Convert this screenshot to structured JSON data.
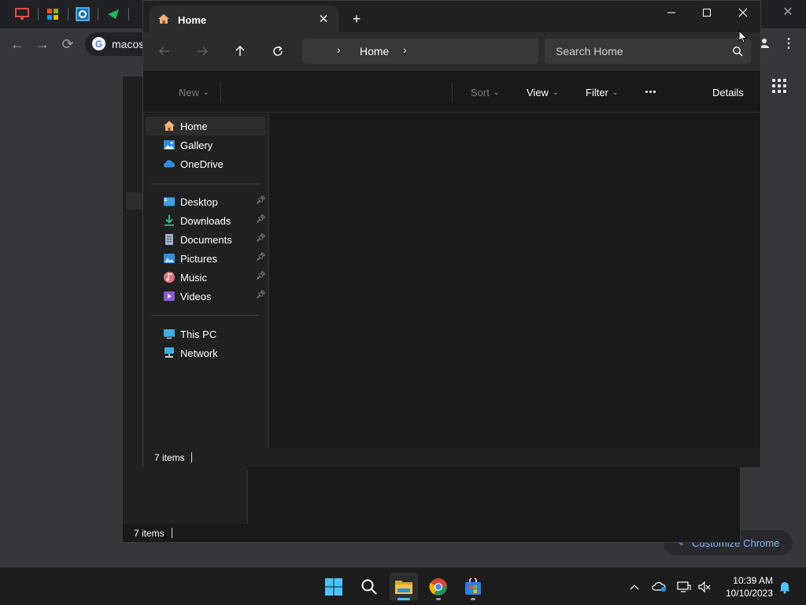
{
  "chrome": {
    "omnibox_text": "macos",
    "google_letter": "G",
    "customize_label": "Customize Chrome"
  },
  "back_explorer": {
    "status_count": "7 items"
  },
  "explorer": {
    "tab_title": "Home",
    "address": {
      "crumb": "Home",
      "search_placeholder": "Search Home"
    },
    "commands": {
      "new": "New",
      "sort": "Sort",
      "view": "View",
      "filter": "Filter",
      "details": "Details"
    },
    "sidebar": {
      "quick": [
        {
          "label": "Home",
          "icon": "home-icon",
          "selected": true
        },
        {
          "label": "Gallery",
          "icon": "gallery-icon"
        },
        {
          "label": "OneDrive",
          "icon": "onedrive-icon"
        }
      ],
      "pinned": [
        {
          "label": "Desktop",
          "icon": "desktop-icon"
        },
        {
          "label": "Downloads",
          "icon": "downloads-icon"
        },
        {
          "label": "Documents",
          "icon": "documents-icon"
        },
        {
          "label": "Pictures",
          "icon": "pictures-icon"
        },
        {
          "label": "Music",
          "icon": "music-icon"
        },
        {
          "label": "Videos",
          "icon": "videos-icon"
        }
      ],
      "system": [
        {
          "label": "This PC",
          "icon": "this-pc-icon"
        },
        {
          "label": "Network",
          "icon": "network-icon"
        }
      ]
    },
    "status_count": "7 items"
  },
  "taskbar": {
    "apps": [
      "start-icon",
      "search-icon",
      "file-explorer-icon",
      "chrome-icon",
      "store-icon"
    ],
    "clock_time": "10:39 AM",
    "clock_date": "10/10/2023"
  },
  "colors": {
    "accent": "#4cc2ff",
    "folder_yellow": "#f6c445"
  }
}
